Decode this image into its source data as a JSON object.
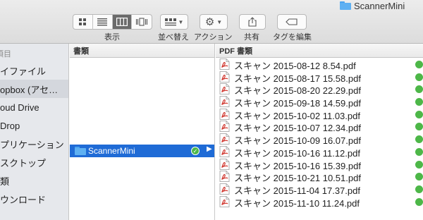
{
  "window": {
    "title": "ScannerMini"
  },
  "toolbar": {
    "view_label": "表示",
    "arrange_label": "並べ替え",
    "action_label": "アクション",
    "share_label": "共有",
    "tags_label": "タグを編集"
  },
  "sidebar": {
    "section": "項目",
    "items": [
      {
        "label": "イファイル"
      },
      {
        "label": "opbox (アセ…"
      },
      {
        "label": "oud Drive"
      },
      {
        "label": "Drop"
      },
      {
        "label": "プリケーション"
      },
      {
        "label": "スクトップ"
      },
      {
        "label": "類"
      },
      {
        "label": "ウンロード"
      }
    ],
    "selected_index": 1
  },
  "column1": {
    "header": "書類",
    "selected_folder": "ScannerMini"
  },
  "column2": {
    "header": "PDF 書類",
    "files": [
      "スキャン 2015-08-12 8.54.pdf",
      "スキャン 2015-08-17 15.58.pdf",
      "スキャン 2015-08-20 22.29.pdf",
      "スキャン 2015-09-18 14.59.pdf",
      "スキャン 2015-10-02 11.03.pdf",
      "スキャン 2015-10-07 12.34.pdf",
      "スキャン 2015-10-09 16.07.pdf",
      "スキャン 2015-10-16 11.12.pdf",
      "スキャン 2015-10-16 15.39.pdf",
      "スキャン 2015-10-21 10.51.pdf",
      "スキャン 2015-11-04 17.37.pdf",
      "スキャン 2015-11-10 11.24.pdf"
    ]
  },
  "colors": {
    "selection": "#1f6bd6",
    "sync_ok": "#4db748",
    "folder": "#5eb0f2",
    "pdf_red": "#d0342c"
  }
}
